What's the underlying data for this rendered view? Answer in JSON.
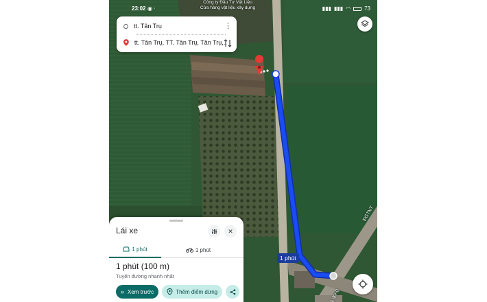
{
  "status": {
    "time": "23:02",
    "battery": "73"
  },
  "poi": {
    "name": "Công ty Đầu Tư Vật Liệu",
    "desc": "Cửa hàng vật liệu xây dựng"
  },
  "route": {
    "origin": "tt. Tân Trụ",
    "destination": "tt. Tân Trụ, TT. Tân Trụ, Tân Trụ,..."
  },
  "map": {
    "duration_label": "1 phút",
    "road_label_1": "ĐGTNT",
    "road_label_2": "ê đông"
  },
  "sheet": {
    "title": "Lái xe",
    "tab_car": "1 phút",
    "tab_bike": "1 phút",
    "duration": "1 phút (100 m)",
    "subtitle": "Tuyến đường nhanh nhất",
    "btn_preview": "Xem trước",
    "btn_add_stop": "Thêm điểm dừng"
  },
  "colors": {
    "route": "#1a3de8",
    "accent": "#0b6b66",
    "pin": "#e53935"
  }
}
